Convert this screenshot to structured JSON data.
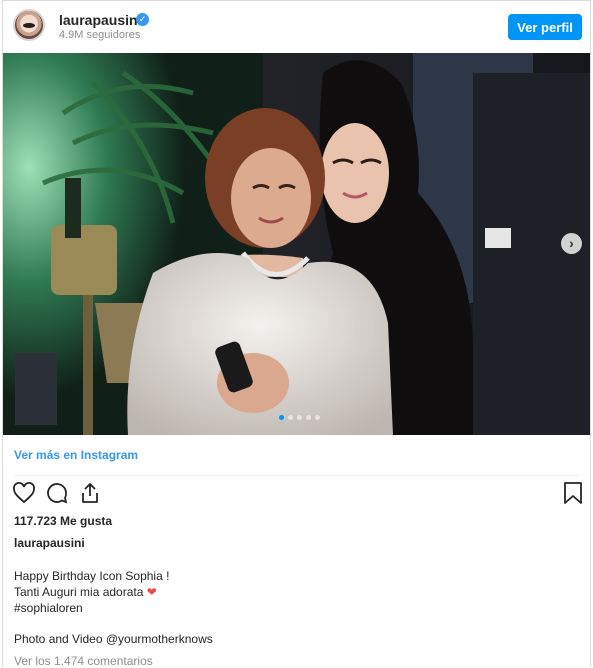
{
  "header": {
    "username": "laurapausini",
    "followers": "4.9M seguidores",
    "view_profile": "Ver perfil"
  },
  "carousel": {
    "slides": 5,
    "active_slide": 1
  },
  "post": {
    "more_link": "Ver más en Instagram",
    "likes": "117.723 Me gusta",
    "caption_user": "laurapausini",
    "caption_lines": [
      "Happy Birthday Icon Sophia !",
      "Tanti Auguri mia adorata",
      "#sophialoren"
    ],
    "heart_emoji": "❤",
    "credit": "Photo and Video @yourmotherknows",
    "comments": "Ver los 1.474 comentarios"
  },
  "colors": {
    "accent": "#0095f6",
    "link": "#3897f0",
    "muted": "#8e8e8e",
    "heart": "#ed4956"
  }
}
